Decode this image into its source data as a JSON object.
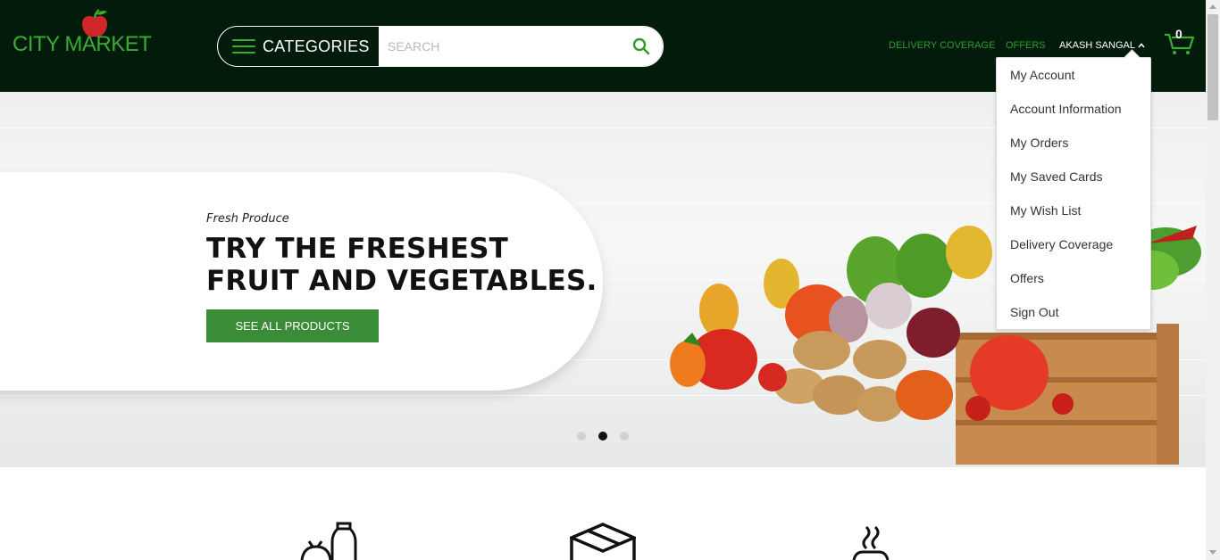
{
  "header": {
    "logo_text": "CITY MARKET",
    "categories_label": "CATEGORIES",
    "search": {
      "placeholder": "SEARCH",
      "value": ""
    },
    "nav": {
      "delivery": "DELIVERY COVERAGE",
      "offers": "OFFERS",
      "user": "AKASH SANGAL"
    },
    "cart_count": "0"
  },
  "hero": {
    "subtitle": "Fresh Produce",
    "title_line1": "TRY THE FRESHEST",
    "title_line2": "FRUIT AND VEGETABLES.",
    "button": "SEE ALL PRODUCTS",
    "slides": {
      "count": 3,
      "active": 2
    }
  },
  "account_menu": {
    "items": [
      {
        "label": "My Account"
      },
      {
        "label": "Account Information"
      },
      {
        "label": "My Orders"
      },
      {
        "label": "My Saved Cards"
      },
      {
        "label": "My Wish List"
      },
      {
        "label": "Delivery Coverage"
      },
      {
        "label": "Offers"
      },
      {
        "label": "Sign Out"
      }
    ]
  },
  "features": [
    {
      "icon": "grocery-icon"
    },
    {
      "icon": "box-icon"
    },
    {
      "icon": "hot-food-icon"
    }
  ],
  "colors": {
    "header_bg": "#031b0b",
    "brand_green": "#3cab34",
    "link_green": "#2e9d2c",
    "button_green": "#3a8c36",
    "apple_red": "#d0262a"
  }
}
